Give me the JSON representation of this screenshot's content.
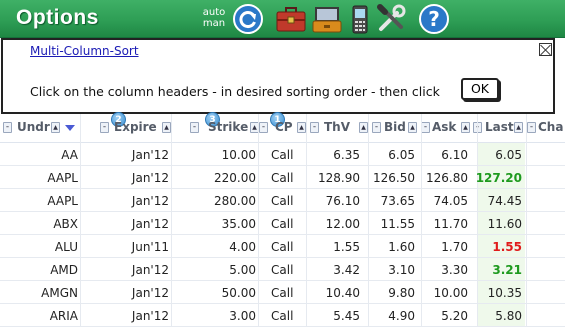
{
  "app": {
    "title": "Options",
    "automan_line1": "auto",
    "automan_line2": "man",
    "toolbar": [
      {
        "name": "refresh-icon",
        "color": "#2a78c8"
      },
      {
        "name": "toolbox-icon",
        "color": "#c0392b"
      },
      {
        "name": "briefcase-icon",
        "color": "#d98b1c"
      },
      {
        "name": "phone-icon",
        "color": "#4a4a4a"
      },
      {
        "name": "tools-icon",
        "color": "#d0d0d0"
      },
      {
        "name": "help-icon",
        "color": "#2a78c8"
      }
    ]
  },
  "sort_hint": {
    "title": "Multi-Column-Sort",
    "message": "Click on the column headers - in desired sorting order - then click",
    "ok_label": "OK"
  },
  "table": {
    "columns": [
      {
        "label": "Undr",
        "ctl": "-",
        "badge": "",
        "sort": "desc"
      },
      {
        "label": "Expire",
        "ctl": "-",
        "badge": "2",
        "sort": ""
      },
      {
        "label": "Strike",
        "ctl": "-",
        "badge": "3",
        "sort": ""
      },
      {
        "label": "CP",
        "ctl": "-",
        "badge": "1",
        "sort": ""
      },
      {
        "label": "ThV",
        "ctl": "-",
        "badge": "",
        "sort": ""
      },
      {
        "label": "Bid",
        "ctl": "-",
        "badge": "",
        "sort": ""
      },
      {
        "label": "Ask",
        "ctl": "-",
        "badge": "",
        "sort": ""
      },
      {
        "label": "Last",
        "ctl": "-",
        "badge": "",
        "sort": ""
      },
      {
        "label": "Cha",
        "ctl": "-",
        "badge": "",
        "sort": ""
      }
    ],
    "rows": [
      {
        "undr": "AA",
        "expire": "Jan'12",
        "strike": "10.00",
        "cp": "Call",
        "thv": "6.35",
        "bid": "6.05",
        "ask": "6.10",
        "last": "6.05",
        "last_color": "#222222"
      },
      {
        "undr": "AAPL",
        "expire": "Jan'12",
        "strike": "220.00",
        "cp": "Call",
        "thv": "128.90",
        "bid": "126.50",
        "ask": "126.80",
        "last": "127.20",
        "last_color": "#1e9a1e"
      },
      {
        "undr": "AAPL",
        "expire": "Jan'12",
        "strike": "280.00",
        "cp": "Call",
        "thv": "76.10",
        "bid": "73.65",
        "ask": "74.05",
        "last": "74.45",
        "last_color": "#222222"
      },
      {
        "undr": "ABX",
        "expire": "Jan'12",
        "strike": "35.00",
        "cp": "Call",
        "thv": "12.00",
        "bid": "11.55",
        "ask": "11.70",
        "last": "11.60",
        "last_color": "#222222"
      },
      {
        "undr": "ALU",
        "expire": "Jun'11",
        "strike": "4.00",
        "cp": "Call",
        "thv": "1.55",
        "bid": "1.60",
        "ask": "1.70",
        "last": "1.55",
        "last_color": "#e01b1b"
      },
      {
        "undr": "AMD",
        "expire": "Jan'12",
        "strike": "5.00",
        "cp": "Call",
        "thv": "3.42",
        "bid": "3.10",
        "ask": "3.30",
        "last": "3.21",
        "last_color": "#1e9a1e"
      },
      {
        "undr": "AMGN",
        "expire": "Jan'12",
        "strike": "50.00",
        "cp": "Call",
        "thv": "10.40",
        "bid": "9.80",
        "ask": "10.00",
        "last": "10.35",
        "last_color": "#222222"
      },
      {
        "undr": "ARIA",
        "expire": "Jan'12",
        "strike": "3.00",
        "cp": "Call",
        "thv": "5.45",
        "bid": "4.90",
        "ask": "5.20",
        "last": "5.80",
        "last_color": "#222222"
      }
    ]
  }
}
